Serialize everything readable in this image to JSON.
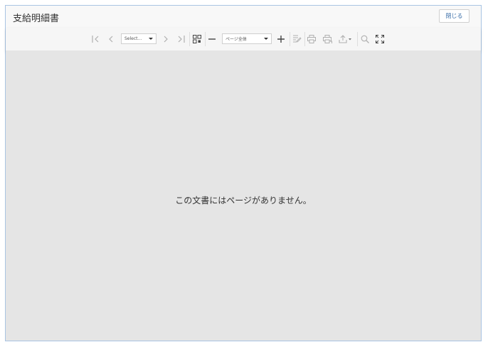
{
  "dialog": {
    "title": "支給明細書",
    "close_label": "閉じる"
  },
  "toolbar": {
    "page_select": {
      "value": "Select..."
    },
    "zoom_select": {
      "value": "ページ全体"
    }
  },
  "viewer": {
    "empty_message": "この文書にはページがありません。"
  }
}
